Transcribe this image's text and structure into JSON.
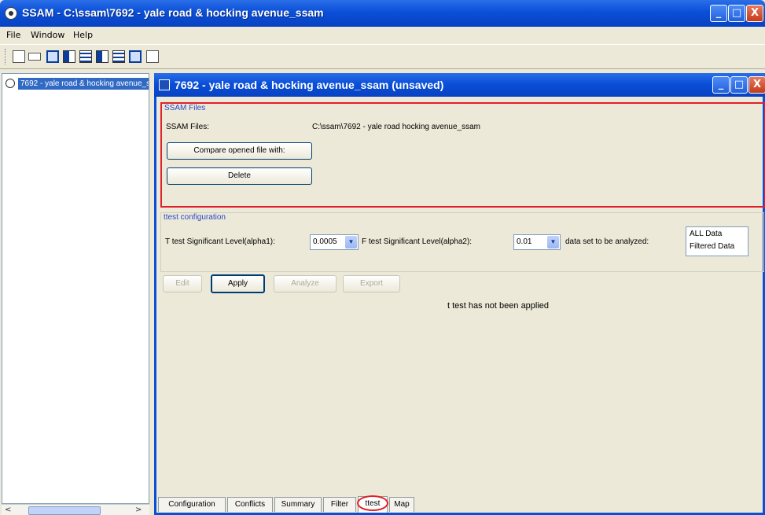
{
  "window": {
    "title": "SSAM - C:\\ssam\\7692 - yale road & hocking avenue_ssam",
    "min": "_",
    "max": "□",
    "close": "X"
  },
  "menu": [
    "File",
    "Window",
    "Help"
  ],
  "toolbar": {
    "icons": [
      "new-file-icon",
      "open-icon",
      "save-icon",
      "window-icon",
      "list-icon",
      "table-icon",
      "grid-icon",
      "chart-icon",
      "help-icon"
    ]
  },
  "sidebar": {
    "items": [
      {
        "label": "7692 - yale road & hocking avenue_ssam"
      }
    ],
    "scroll_left": "<",
    "scroll_right": ">"
  },
  "doc": {
    "title": "7692 - yale road & hocking avenue_ssam (unsaved)",
    "min": "_",
    "max": "□",
    "close": "X"
  },
  "files": {
    "legend": "SSAM Files",
    "label": "SSAM Files:",
    "path": "C:\\ssam\\7692 - yale road  hocking avenue_ssam",
    "compare_button": "Compare opened file with:",
    "delete_button": "Delete"
  },
  "config": {
    "legend": "ttest configuration",
    "alpha1_label": "T test Significant Level(alpha1):",
    "alpha1_value": "0.0005",
    "alpha2_label": "F test Significant Level(alpha2):",
    "alpha2_value": "0.01",
    "dataset_label": "data set to be analyzed:",
    "dataset_options": [
      "ALL Data",
      "Filtered Data"
    ]
  },
  "actions": {
    "edit": "Edit",
    "apply": "Apply",
    "analyze": "Analyze",
    "export": "Export"
  },
  "status": "t test has not been applied",
  "tabs": [
    {
      "label": "Configuration"
    },
    {
      "label": "Conflicts"
    },
    {
      "label": "Summary"
    },
    {
      "label": "Filter"
    },
    {
      "label": "ttest"
    },
    {
      "label": "Map"
    }
  ],
  "active_tab": "ttest",
  "colors": {
    "titlebar": "#0a4fd8",
    "highlight": "#e0202a",
    "legend": "#2b47c9"
  }
}
